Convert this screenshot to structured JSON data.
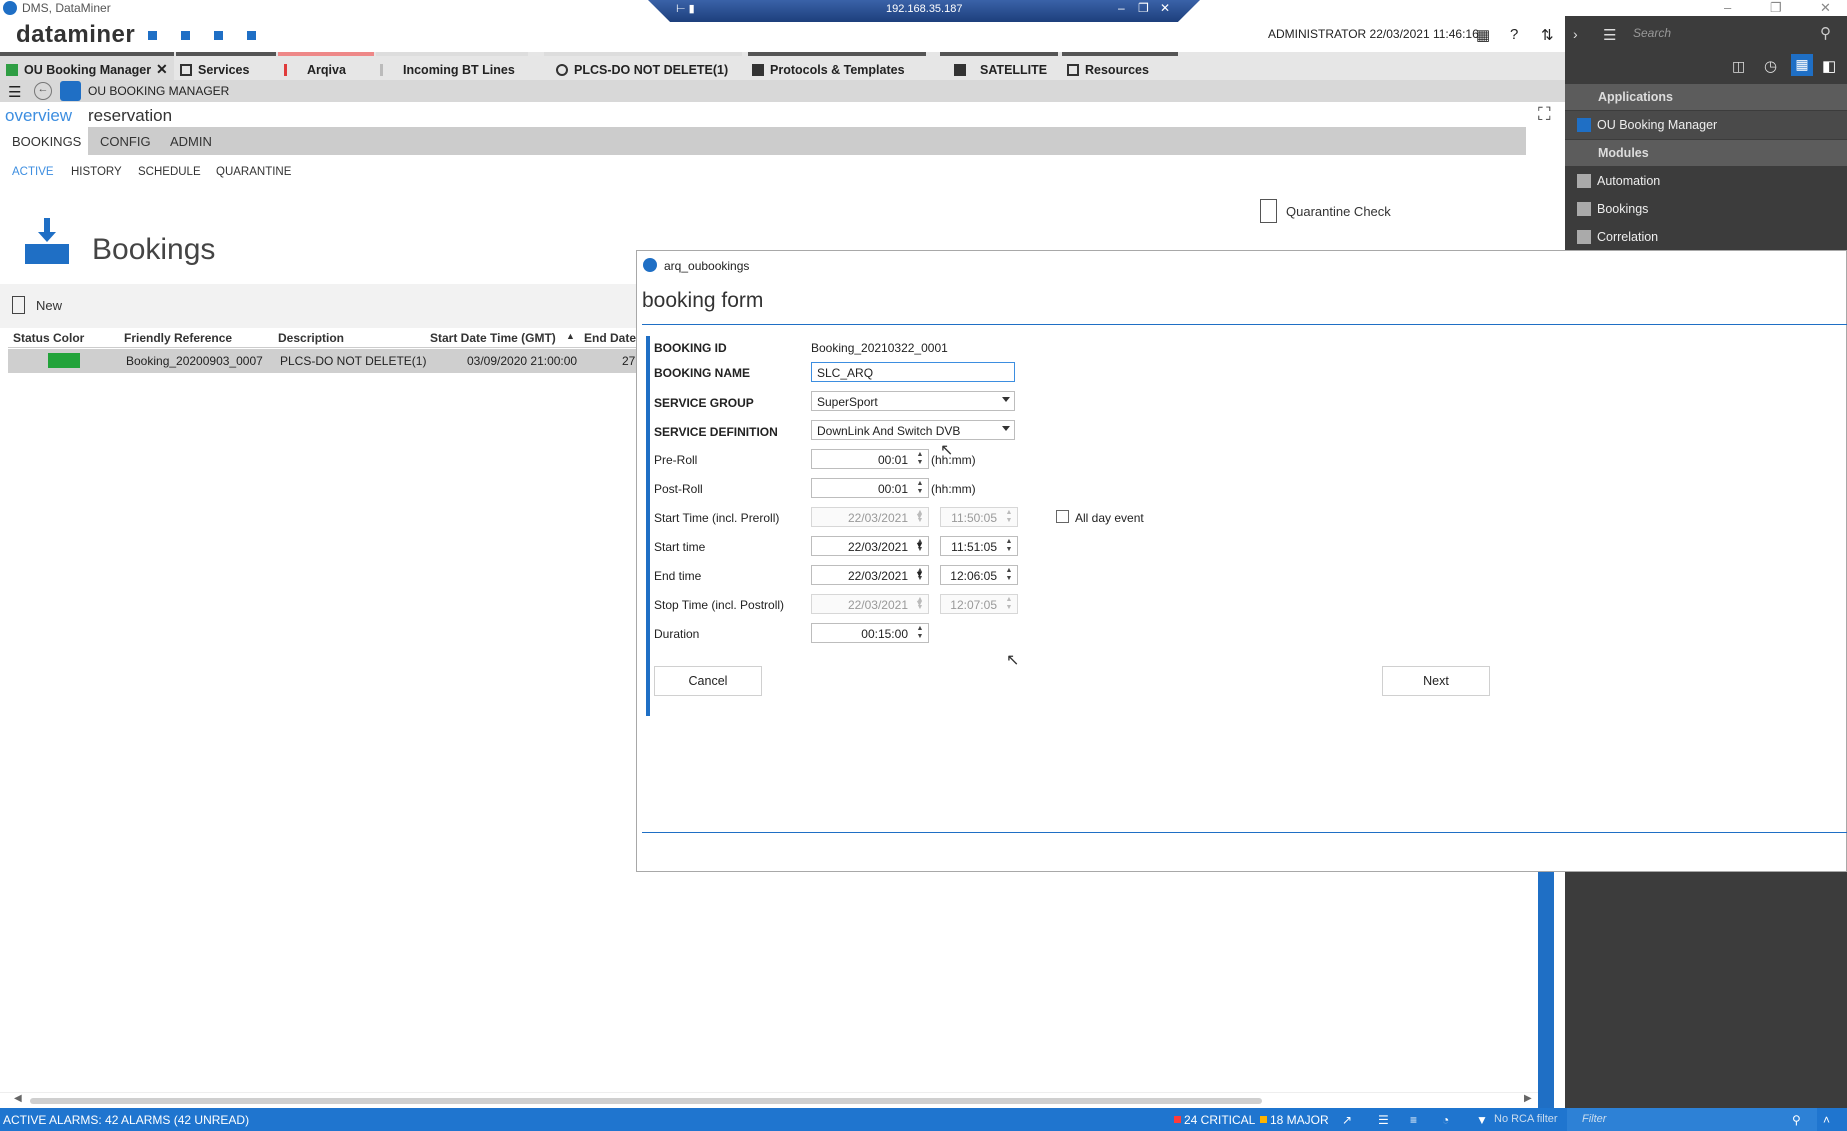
{
  "window": {
    "title": "DMS, DataMiner",
    "remote_ip": "192.168.35.187"
  },
  "header": {
    "brand": "dataminer",
    "user_info": "ADMINISTRATOR 22/03/2021 11:46:16"
  },
  "tabs": [
    {
      "label": "OU Booking Manager",
      "accent": "#2f9e44"
    },
    {
      "label": "Services",
      "accent": "#222222"
    },
    {
      "label": "Arqiva",
      "accent": "#e03b3b"
    },
    {
      "label": "Incoming BT Lines",
      "accent": "#bbbbbb"
    },
    {
      "label": "PLCS-DO NOT DELETE(1)",
      "accent": "#bbbbbb"
    },
    {
      "label": "Protocols & Templates",
      "accent": "#333333"
    },
    {
      "label": "SATELLITE",
      "accent": "#333333"
    },
    {
      "label": "Resources",
      "accent": "#333333"
    }
  ],
  "breadcrumb": {
    "title": "OU BOOKING MANAGER"
  },
  "modes": {
    "overview": "overview",
    "reservation": "reservation"
  },
  "sections": [
    "BOOKINGS",
    "CONFIG",
    "ADMIN"
  ],
  "subtabs": [
    "ACTIVE",
    "HISTORY",
    "SCHEDULE",
    "QUARANTINE"
  ],
  "quarantine_check": "Quarantine Check",
  "bookings": {
    "title": "Bookings",
    "new_label": "New",
    "columns": [
      "Status Color",
      "Friendly Reference",
      "Description",
      "Start Date Time (GMT)",
      "End Date"
    ],
    "rows": [
      {
        "status_color": "#22a33a",
        "friendly_reference": "Booking_20200903_0007",
        "description": "PLCS-DO NOT DELETE(1)",
        "start": "03/09/2020 21:00:00",
        "end": "27"
      }
    ]
  },
  "sidebar": {
    "search_placeholder": "Search",
    "applications_label": "Applications",
    "applications": [
      "OU Booking Manager"
    ],
    "modules_label": "Modules",
    "modules": [
      "Automation",
      "Bookings",
      "Correlation"
    ]
  },
  "dialog": {
    "window_title": "arq_oubookings",
    "heading": "booking form",
    "fields": {
      "booking_id_label": "BOOKING ID",
      "booking_id": "Booking_20210322_0001",
      "booking_name_label": "BOOKING NAME",
      "booking_name": "SLC_ARQ",
      "service_group_label": "SERVICE GROUP",
      "service_group": "SuperSport",
      "service_definition_label": "SERVICE DEFINITION",
      "service_definition": "DownLink And Switch DVB",
      "pre_roll_label": "Pre-Roll",
      "pre_roll": "00:01",
      "post_roll_label": "Post-Roll",
      "post_roll": "00:01",
      "unit": "(hh:mm)",
      "start_incl_label": "Start Time (incl. Preroll)",
      "start_incl_date": "22/03/2021",
      "start_incl_time": "11:50:05",
      "all_day_label": "All day event",
      "start_label": "Start time",
      "start_date": "22/03/2021",
      "start_time": "11:51:05",
      "end_label": "End time",
      "end_date": "22/03/2021",
      "end_time": "12:06:05",
      "stop_incl_label": "Stop Time (incl. Postroll)",
      "stop_incl_date": "22/03/2021",
      "stop_incl_time": "12:07:05",
      "duration_label": "Duration",
      "duration": "00:15:00"
    },
    "cancel_label": "Cancel",
    "next_label": "Next"
  },
  "statusbar": {
    "alarms": "ACTIVE ALARMS: 42 ALARMS (42 UNREAD)",
    "critical": "24 CRITICAL",
    "major": "18 MAJOR",
    "rca": "No RCA filter",
    "filter_placeholder": "Filter"
  }
}
